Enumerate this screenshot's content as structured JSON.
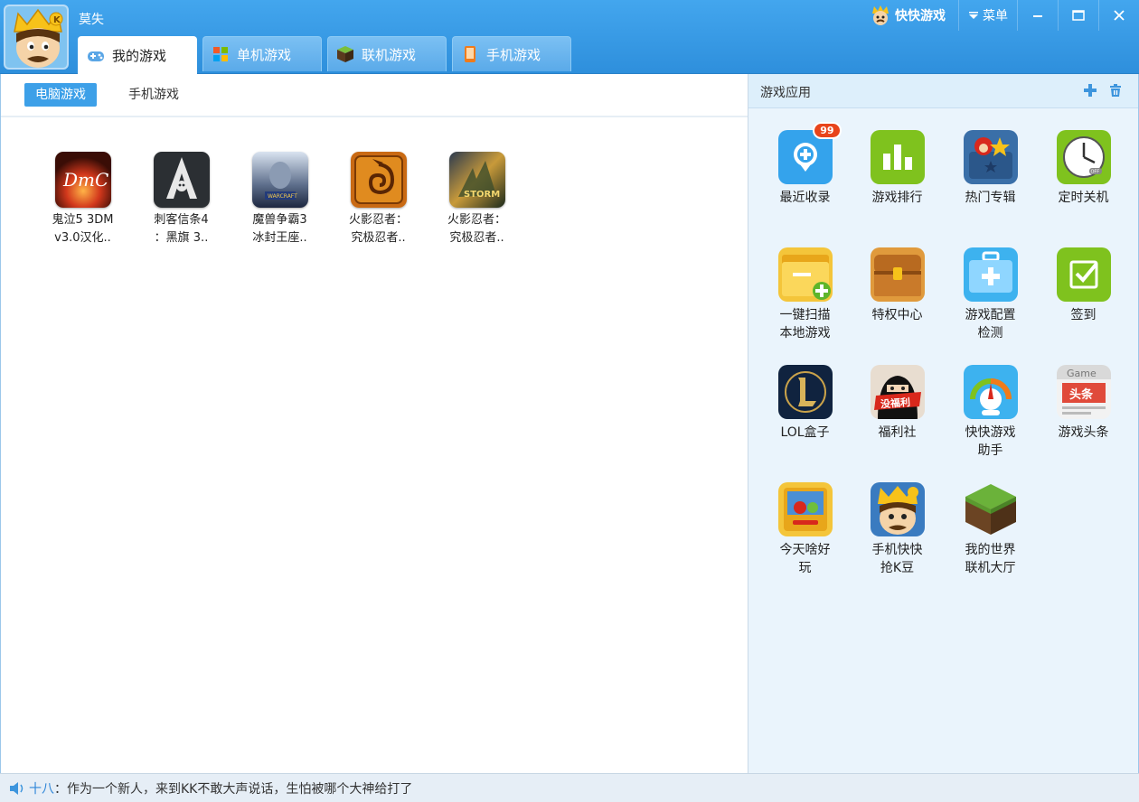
{
  "window": {
    "user_name": "莫失",
    "brand": "快快游戏",
    "menu_label": "菜单"
  },
  "tabs": [
    {
      "label": "我的游戏",
      "active": true,
      "icon": "gamepad-icon"
    },
    {
      "label": "单机游戏",
      "active": false,
      "icon": "windows-icon"
    },
    {
      "label": "联机游戏",
      "active": false,
      "icon": "cube-icon"
    },
    {
      "label": "手机游戏",
      "active": false,
      "icon": "phone-icon"
    }
  ],
  "subtabs": [
    {
      "label": "电脑游戏",
      "active": true
    },
    {
      "label": "手机游戏",
      "active": false
    }
  ],
  "games": [
    {
      "line1": "鬼泣5 3DM",
      "line2": "v3.0汉化..",
      "icon": "dmc-icon"
    },
    {
      "line1": "刺客信条4",
      "line2": "：黑旗 3..",
      "icon": "assassins-creed-icon"
    },
    {
      "line1": "魔兽争霸3",
      "line2": "冰封王座..",
      "icon": "warcraft-icon"
    },
    {
      "line1": "火影忍者：",
      "line2": "究极忍者..",
      "icon": "naruto-icon"
    },
    {
      "line1": "火影忍者：",
      "line2": "究极忍者..",
      "icon": "naruto-storm-icon"
    }
  ],
  "apps_panel": {
    "title": "游戏应用",
    "add_icon": "plus-icon",
    "delete_icon": "trash-icon"
  },
  "apps": [
    {
      "label": "最近收录",
      "icon": "recent-add-icon",
      "badge": "99"
    },
    {
      "label": "游戏排行",
      "icon": "ranking-chart-icon"
    },
    {
      "label": "热门专辑",
      "icon": "hot-album-icon"
    },
    {
      "label": "定时关机",
      "icon": "timer-shutdown-icon"
    },
    {
      "label": "一键扫描\n本地游戏",
      "icon": "folder-scan-icon"
    },
    {
      "label": "特权中心",
      "icon": "treasure-chest-icon"
    },
    {
      "label": "游戏配置\n检测",
      "icon": "first-aid-kit-icon"
    },
    {
      "label": "签到",
      "icon": "checkbox-icon"
    },
    {
      "label": "LOL盒子",
      "icon": "lol-icon"
    },
    {
      "label": "福利社",
      "icon": "welfare-icon",
      "icon_text": "没福利"
    },
    {
      "label": "快快游戏\n助手",
      "icon": "assistant-gauge-icon"
    },
    {
      "label": "游戏头条",
      "icon": "game-news-icon",
      "icon_text": "Game",
      "icon_text2": "头条"
    },
    {
      "label": "今天啥好\n玩",
      "icon": "angry-birds-icon"
    },
    {
      "label": "手机快快\n抢K豆",
      "icon": "kk-mascot-icon"
    },
    {
      "label": "我的世界\n联机大厅",
      "icon": "minecraft-grass-icon"
    }
  ],
  "status": {
    "user": "十八",
    "message": "：作为一个新人，来到KK不敢大声说话，生怕被哪个大神给打了"
  }
}
